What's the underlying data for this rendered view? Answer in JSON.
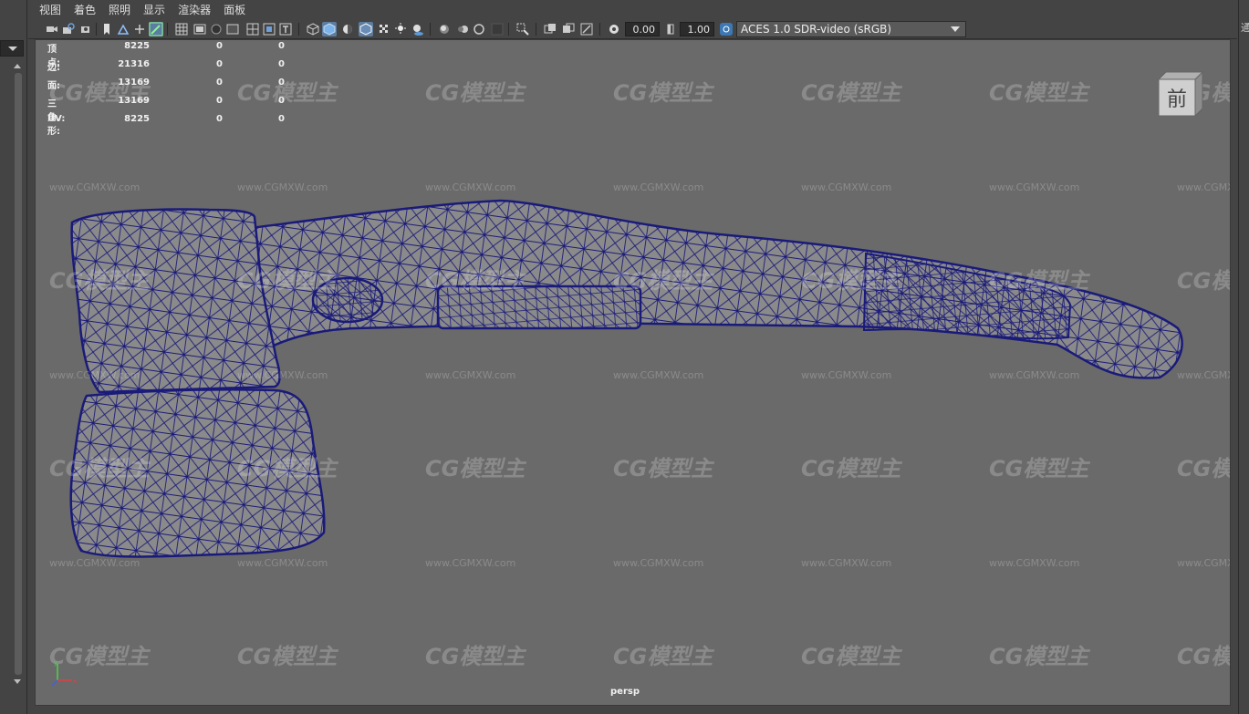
{
  "menu": {
    "items": [
      "视图",
      "着色",
      "照明",
      "显示",
      "渲染器",
      "面板"
    ]
  },
  "toolbar": {
    "exposure_value": "0.00",
    "gamma_value": "1.00",
    "color_management_view": "ACES 1.0 SDR-video (sRGB)"
  },
  "hud": {
    "rows": [
      {
        "label": "顶点:",
        "v1": "8225",
        "v2": "0",
        "v3": "0"
      },
      {
        "label": "边:",
        "v1": "21316",
        "v2": "0",
        "v3": "0"
      },
      {
        "label": "面:",
        "v1": "13169",
        "v2": "0",
        "v3": "0"
      },
      {
        "label": "三角形:",
        "v1": "13169",
        "v2": "0",
        "v3": "0"
      },
      {
        "label": "UV:",
        "v1": "8225",
        "v2": "0",
        "v3": "0"
      }
    ]
  },
  "viewport": {
    "camera_name": "persp",
    "view_cube_label": "前",
    "background_color": "#6a6a6a",
    "wireframe_color": "#1a1a7a",
    "model_fill_color": "#8a8a8a"
  },
  "watermark": {
    "logo_text": "CG模型主",
    "url_text": "www.CGMXW.com"
  },
  "right_strip": {
    "text": "通"
  },
  "icons": [
    "camera-icon",
    "lock-camera-icon",
    "bookmark-icon",
    "image-plane-icon",
    "grid-icon",
    "film-gate-icon",
    "resolution-gate-icon",
    "wireframe-shading-icon",
    "smooth-shading-icon",
    "textured-icon",
    "lights-icon",
    "shadows-icon",
    "ambient-occlusion-icon",
    "xray-icon",
    "isolate-select-icon",
    "exposure-icon",
    "gamma-icon",
    "color-management-icon"
  ]
}
